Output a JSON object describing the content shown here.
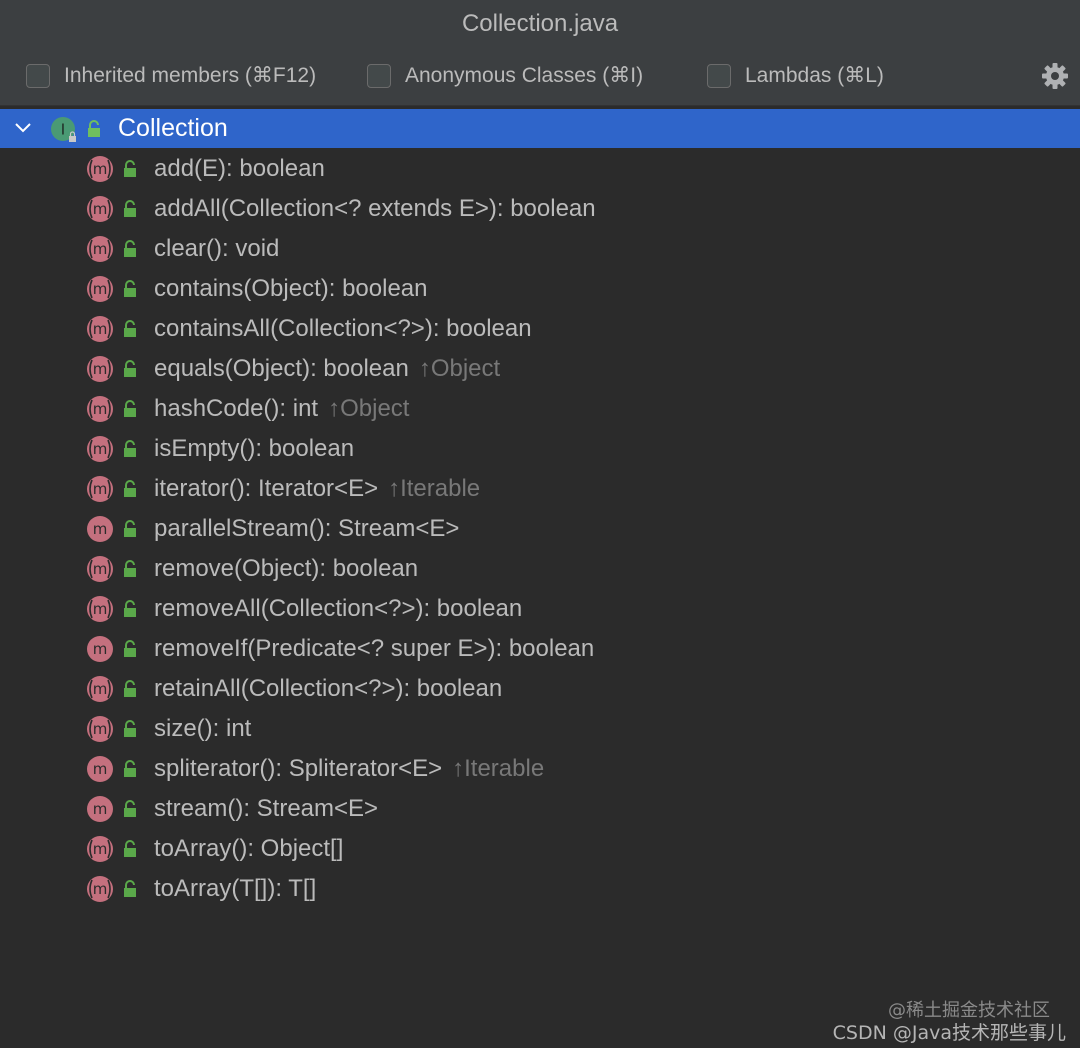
{
  "window": {
    "title": "Collection.java"
  },
  "toolbar": {
    "options": [
      {
        "label": "Inherited members (⌘F12)",
        "checked": false
      },
      {
        "label": "Anonymous Classes (⌘I)",
        "checked": false
      },
      {
        "label": "Lambdas (⌘L)",
        "checked": false
      }
    ],
    "settings_icon": "gear-icon"
  },
  "tree": {
    "root": {
      "label": "Collection",
      "icon": "interface-icon",
      "expanded": true,
      "selected": true
    },
    "members": [
      {
        "sig": "add(E): boolean",
        "inherited": "",
        "abstract": true
      },
      {
        "sig": "addAll(Collection<? extends E>): boolean",
        "inherited": "",
        "abstract": true
      },
      {
        "sig": "clear(): void",
        "inherited": "",
        "abstract": true
      },
      {
        "sig": "contains(Object): boolean",
        "inherited": "",
        "abstract": true
      },
      {
        "sig": "containsAll(Collection<?>): boolean",
        "inherited": "",
        "abstract": true
      },
      {
        "sig": "equals(Object): boolean",
        "inherited": "↑Object",
        "abstract": true
      },
      {
        "sig": "hashCode(): int",
        "inherited": "↑Object",
        "abstract": true
      },
      {
        "sig": "isEmpty(): boolean",
        "inherited": "",
        "abstract": true
      },
      {
        "sig": "iterator(): Iterator<E>",
        "inherited": "↑Iterable",
        "abstract": true
      },
      {
        "sig": "parallelStream(): Stream<E>",
        "inherited": "",
        "abstract": false
      },
      {
        "sig": "remove(Object): boolean",
        "inherited": "",
        "abstract": true
      },
      {
        "sig": "removeAll(Collection<?>): boolean",
        "inherited": "",
        "abstract": true
      },
      {
        "sig": "removeIf(Predicate<? super E>): boolean",
        "inherited": "",
        "abstract": false
      },
      {
        "sig": "retainAll(Collection<?>): boolean",
        "inherited": "",
        "abstract": true
      },
      {
        "sig": "size(): int",
        "inherited": "",
        "abstract": true
      },
      {
        "sig": "spliterator(): Spliterator<E>",
        "inherited": "↑Iterable",
        "abstract": false
      },
      {
        "sig": "stream(): Stream<E>",
        "inherited": "",
        "abstract": false
      },
      {
        "sig": "toArray(): Object[]",
        "inherited": "",
        "abstract": true
      },
      {
        "sig": "toArray(T[]): T[]",
        "inherited": "",
        "abstract": true
      }
    ]
  },
  "watermark": {
    "line1": "@稀土掘金技术社区",
    "line2": "CSDN @Java技术那些事儿"
  },
  "colors": {
    "selection": "#2f65ca",
    "method_icon": "#c4707e",
    "interface_icon": "#4a9a74",
    "lock": "#5aa84a"
  }
}
